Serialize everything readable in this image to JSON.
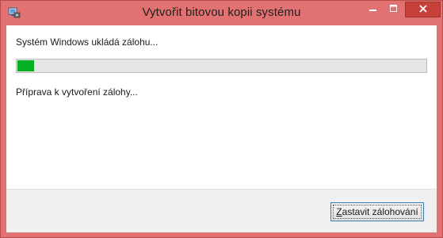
{
  "window": {
    "title": "Vytvořit bitovou kopii systému",
    "app_icon": "backup-icon",
    "controls": {
      "minimize_icon": "minimize-icon",
      "maximize_icon": "maximize-icon",
      "close_icon": "close-icon"
    }
  },
  "main": {
    "status_text": "Systém Windows ukládá zálohu...",
    "progress_percent": 3,
    "detail_text": "Příprava k vytvoření zálohy..."
  },
  "footer": {
    "stop_button": {
      "mnemonic": "Z",
      "label_rest": "astavit zálohování"
    }
  },
  "colors": {
    "window_frame": "#e27272",
    "close_button": "#c7403a",
    "progress_fill": "#06b025",
    "progress_track": "#e6e6e6",
    "footer": "#f0f0f0"
  }
}
